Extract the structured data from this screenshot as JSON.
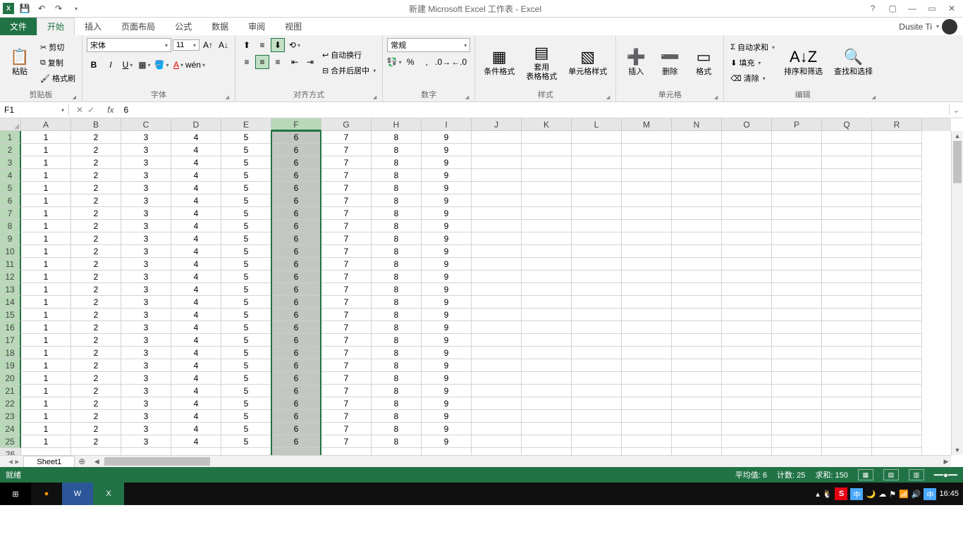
{
  "title": "新建 Microsoft Excel 工作表 - Excel",
  "user": "Dusite Ti",
  "tabs": {
    "file": "文件",
    "home": "开始",
    "insert": "插入",
    "layout": "页面布局",
    "formula": "公式",
    "data": "数据",
    "review": "审阅",
    "view": "视图"
  },
  "ribbon": {
    "clipboard": {
      "paste": "粘贴",
      "cut": "剪切",
      "copy": "复制",
      "painter": "格式刷",
      "label": "剪贴板"
    },
    "font": {
      "name": "宋体",
      "size": "11",
      "label": "字体"
    },
    "align": {
      "wrap": "自动换行",
      "merge": "合并后居中",
      "label": "对齐方式"
    },
    "number": {
      "format": "常规",
      "label": "数字"
    },
    "styles": {
      "cond": "条件格式",
      "table": "套用\n表格格式",
      "cell": "单元格样式",
      "label": "样式"
    },
    "cells": {
      "insert": "插入",
      "delete": "删除",
      "format": "格式",
      "label": "单元格"
    },
    "editing": {
      "sum": "自动求和",
      "fill": "填充",
      "clear": "清除",
      "sort": "排序和筛选",
      "find": "查找和选择",
      "label": "编辑"
    }
  },
  "nameBox": "F1",
  "formula": "6",
  "columns": [
    "A",
    "B",
    "C",
    "D",
    "E",
    "F",
    "G",
    "H",
    "I",
    "J",
    "K",
    "L",
    "M",
    "N",
    "O",
    "P",
    "Q",
    "R"
  ],
  "selectedColumnIndex": 5,
  "rowCount": 27,
  "dataRowCount": 25,
  "rowValues": [
    1,
    2,
    3,
    4,
    5,
    6,
    7,
    8,
    9
  ],
  "sheet": "Sheet1",
  "status": {
    "ready": "就绪",
    "avg_label": "平均值:",
    "avg": "6",
    "count_label": "计数:",
    "count": "25",
    "sum_label": "求和:",
    "sum": "150"
  },
  "clock": "16:45",
  "ime": "中"
}
